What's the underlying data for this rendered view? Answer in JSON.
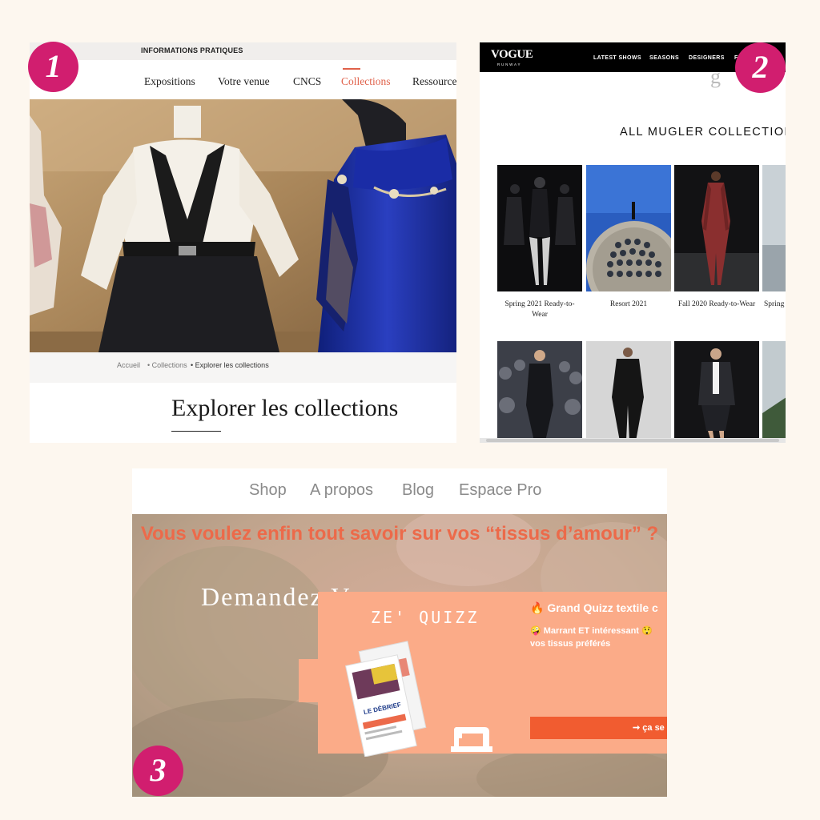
{
  "panel1": {
    "info_bar": "INFORMATIONS PRATIQUES",
    "nav": [
      "Expositions",
      "Votre venue",
      "CNCS",
      "Collections",
      "Ressources"
    ],
    "active_nav": "Collections",
    "breadcrumb": [
      "Accueil",
      "• Collections",
      "• Explorer les collections"
    ],
    "title": "Explorer les collections",
    "accent_color": "#e0614a"
  },
  "panel2": {
    "logo": "VOGUE",
    "logo_sub": "RUNWAY",
    "nav": [
      "LATEST SHOWS",
      "SEASONS",
      "DESIGNERS",
      "F"
    ],
    "section_title": "ALL MUGLER COLLECTIONS",
    "collections": [
      {
        "label": "Spring 2021 Ready-to-Wear"
      },
      {
        "label": "Resort 2021"
      },
      {
        "label": "Fall 2020 Ready-to-Wear"
      },
      {
        "label": "Spring"
      }
    ]
  },
  "panel3": {
    "nav": [
      "Shop",
      "A propos",
      "Blog",
      "Espace Pro"
    ],
    "headline": "Vous voulez enfin tout savoir sur vos “tissus d’amour” ?",
    "subheadline": "Demandez Vos",
    "quiz_title": "ZE' QUIZZ",
    "quiz_heading": "🔥 Grand Quizz textile c",
    "quiz_text_1": "🤪 Marrant ET intéressant 😲",
    "quiz_text_2": "vos tissus préférés",
    "cta": "➞ ça se",
    "booklet_label": "LE DÉBRIEF",
    "accent_color": "#f15c30",
    "card_color": "#fbab88"
  },
  "badges": [
    "1",
    "2",
    "3"
  ],
  "badge_color": "#d11e6f"
}
